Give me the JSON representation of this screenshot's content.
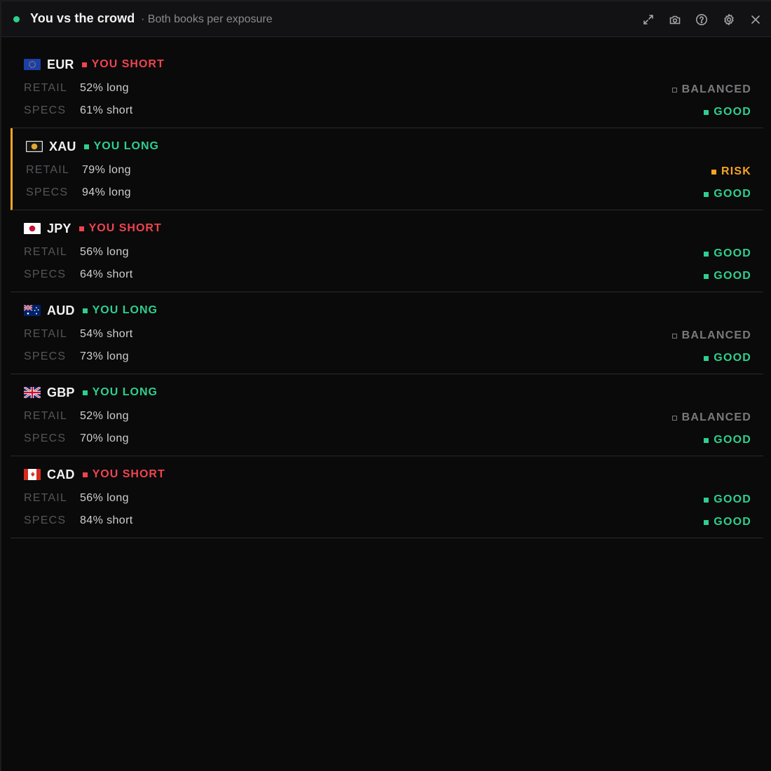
{
  "header": {
    "title": "You vs the crowd",
    "subtitle": "· Both books per exposure",
    "live_color": "#2ecf8f",
    "icons": [
      "expand-icon",
      "camera-icon",
      "help-icon",
      "gear-icon",
      "close-icon"
    ]
  },
  "labels": {
    "retail": "RETAIL",
    "specs": "SPECS"
  },
  "colors": {
    "short": "#f0434f",
    "long": "#2ecf8f",
    "risk": "#f5a524",
    "balanced": "#7a7a7e",
    "highlight": "#f5a524"
  },
  "rows": [
    {
      "ccy": "EUR",
      "flag": "eu-flag-icon",
      "position": "YOU SHORT",
      "side": "short",
      "retail": "52% long",
      "specs": "61% short",
      "retail_status": "BALANCED",
      "specs_status": "GOOD",
      "highlight": false
    },
    {
      "ccy": "XAU",
      "flag": "gold-icon",
      "position": "YOU LONG",
      "side": "long",
      "retail": "79% long",
      "specs": "94% long",
      "retail_status": "RISK",
      "specs_status": "GOOD",
      "highlight": true
    },
    {
      "ccy": "JPY",
      "flag": "jp-flag-icon",
      "position": "YOU SHORT",
      "side": "short",
      "retail": "56% long",
      "specs": "64% short",
      "retail_status": "GOOD",
      "specs_status": "GOOD",
      "highlight": false
    },
    {
      "ccy": "AUD",
      "flag": "au-flag-icon",
      "position": "YOU LONG",
      "side": "long",
      "retail": "54% short",
      "specs": "73% long",
      "retail_status": "BALANCED",
      "specs_status": "GOOD",
      "highlight": false
    },
    {
      "ccy": "GBP",
      "flag": "gb-flag-icon",
      "position": "YOU LONG",
      "side": "long",
      "retail": "52% long",
      "specs": "70% long",
      "retail_status": "BALANCED",
      "specs_status": "GOOD",
      "highlight": false
    },
    {
      "ccy": "CAD",
      "flag": "ca-flag-icon",
      "position": "YOU SHORT",
      "side": "short",
      "retail": "56% long",
      "specs": "84% short",
      "retail_status": "GOOD",
      "specs_status": "GOOD",
      "highlight": false
    }
  ]
}
